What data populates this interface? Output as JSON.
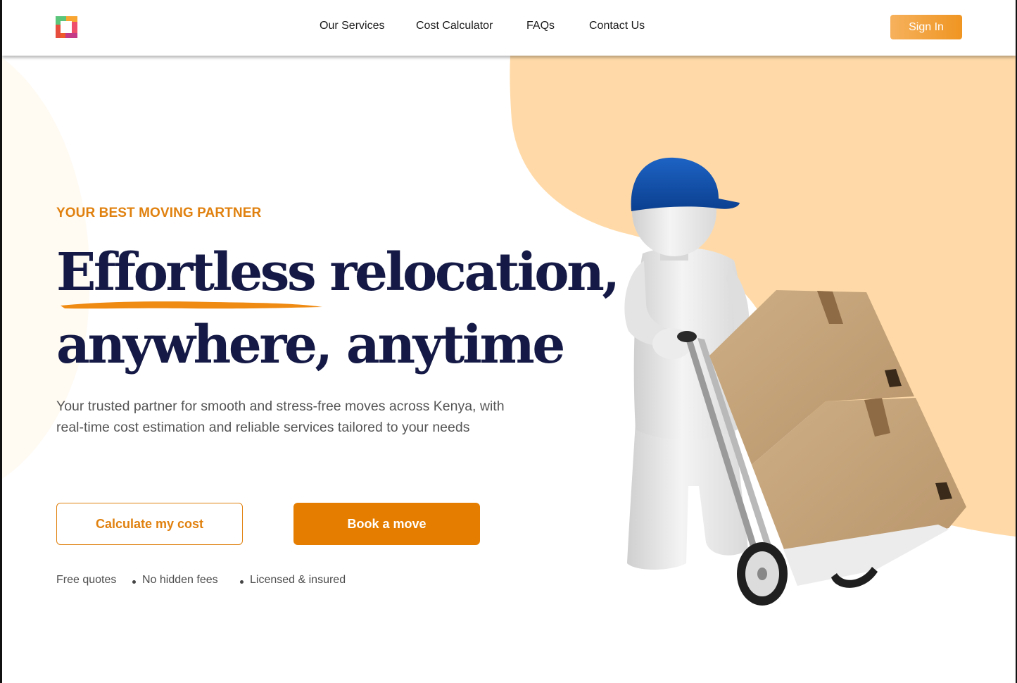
{
  "header": {
    "logo_icon": "colored-square-logo",
    "nav": [
      "Our Services",
      "Cost Calculator",
      "FAQs",
      "Contact Us"
    ],
    "signin_label": "Sign In"
  },
  "hero": {
    "eyebrow": "YOUR BEST MOVING PARTNER",
    "headline_line1": "Effortless relocation,",
    "headline_line2": "anywhere, anytime",
    "lead": "Your trusted partner for smooth and stress-free moves across Kenya, with real-time cost estimation and reliable services tailored to your needs",
    "cta_secondary": "Calculate my cost",
    "cta_primary": "Book a move",
    "perks": [
      "Free quotes",
      "No hidden fees",
      "Licensed & insured"
    ],
    "illustration": "mover-with-hand-truck-and-boxes"
  },
  "colors": {
    "accent": "#E57E00",
    "eyebrow": "#E0810F",
    "headline": "#141A45",
    "blob": "#FFDAA8",
    "signin_gradient_start": "#F6B15C",
    "signin_gradient_end": "#EF9522"
  }
}
